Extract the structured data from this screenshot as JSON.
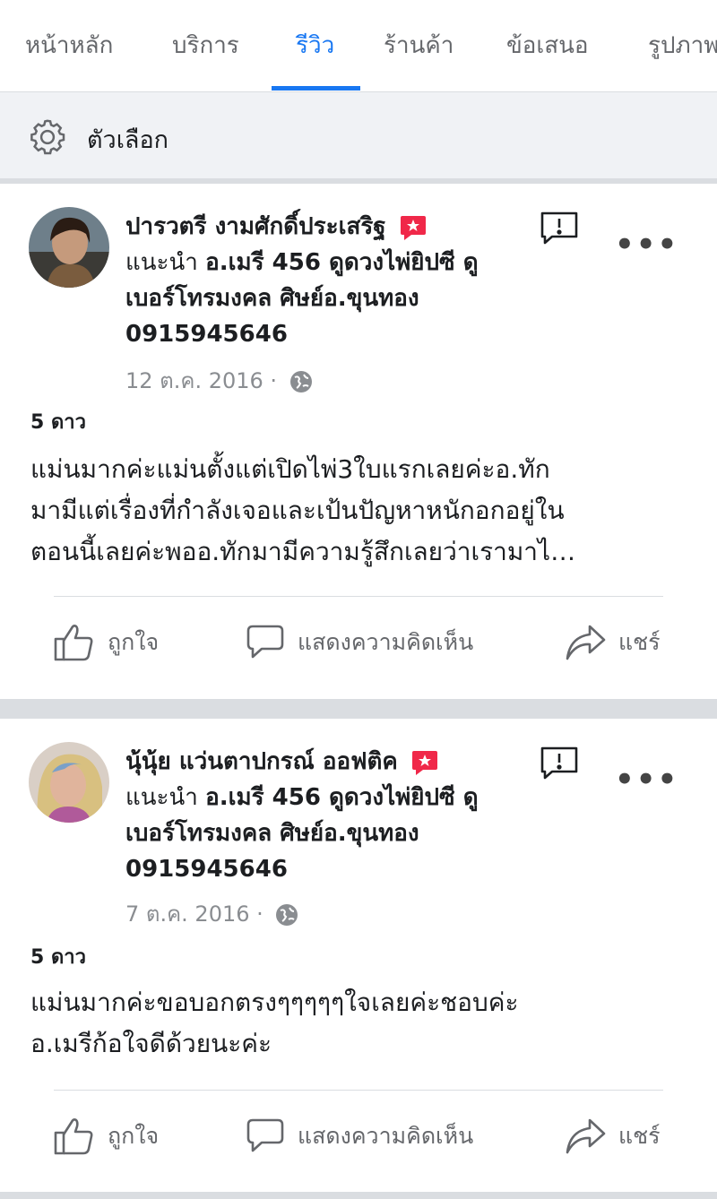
{
  "tabs": [
    {
      "label": "หน้าหลัก",
      "active": false
    },
    {
      "label": "บริการ",
      "active": false
    },
    {
      "label": "รีวิว",
      "active": true
    },
    {
      "label": "ร้านค้า",
      "active": false
    },
    {
      "label": "ข้อเสนอ",
      "active": false
    },
    {
      "label": "รูปภาพ",
      "active": false
    }
  ],
  "options": {
    "label": "ตัวเลือก",
    "icon": "gear-icon"
  },
  "reviews": [
    {
      "author": "ปารวตรี งามศักดิ์ประเสริฐ",
      "recommends_word": "แนะนำ",
      "page_line1": "อ.เมรี 456 ดูดวงไพ่ยิปซี ดู",
      "page_line2": "เบอร์โทรมงคล ศิษย์อ.ขุนทอง",
      "page_line3": "0915945646",
      "date": "12 ต.ค. 2016 ·",
      "rating": "5 ดาว",
      "text_line1": "แม่นมากค่ะแม่นตั้งแต่เปิดไพ่3ใบแรกเลยค่ะอ.ทัก",
      "text_line2": "มามีแต่เรื่องที่กำลังเจอและเป้นปัญหาหนักอกอยู่ใน",
      "text_line3": "ตอนนี้เลยค่ะพออ.ทักมามีความรู้สึกเลยว่าเรามาไ…"
    },
    {
      "author": "นุ้นุ้ย แว่นตาปกรณ์ ออฟติค",
      "recommends_word": "แนะนำ",
      "page_line1": "อ.เมรี 456 ดูดวงไพ่ยิปซี ดู",
      "page_line2": "เบอร์โทรมงคล ศิษย์อ.ขุนทอง",
      "page_line3": "0915945646",
      "date": "7 ต.ค. 2016 ·",
      "rating": "5 ดาว",
      "text_line1": "แม่นมากค่ะขอบอกตรงๆๆๆๆๆใจเลยค่ะชอบค่ะ",
      "text_line2": "อ.เมรีก้อใจดีด้วยนะค่ะ",
      "text_line3": ""
    }
  ],
  "actions": {
    "like": "ถูกใจ",
    "comment": "แสดงความคิดเห็น",
    "share": "แชร์"
  },
  "colors": {
    "accent": "#1877f2",
    "badge": "#f02849",
    "secondary_text": "#65676b"
  }
}
